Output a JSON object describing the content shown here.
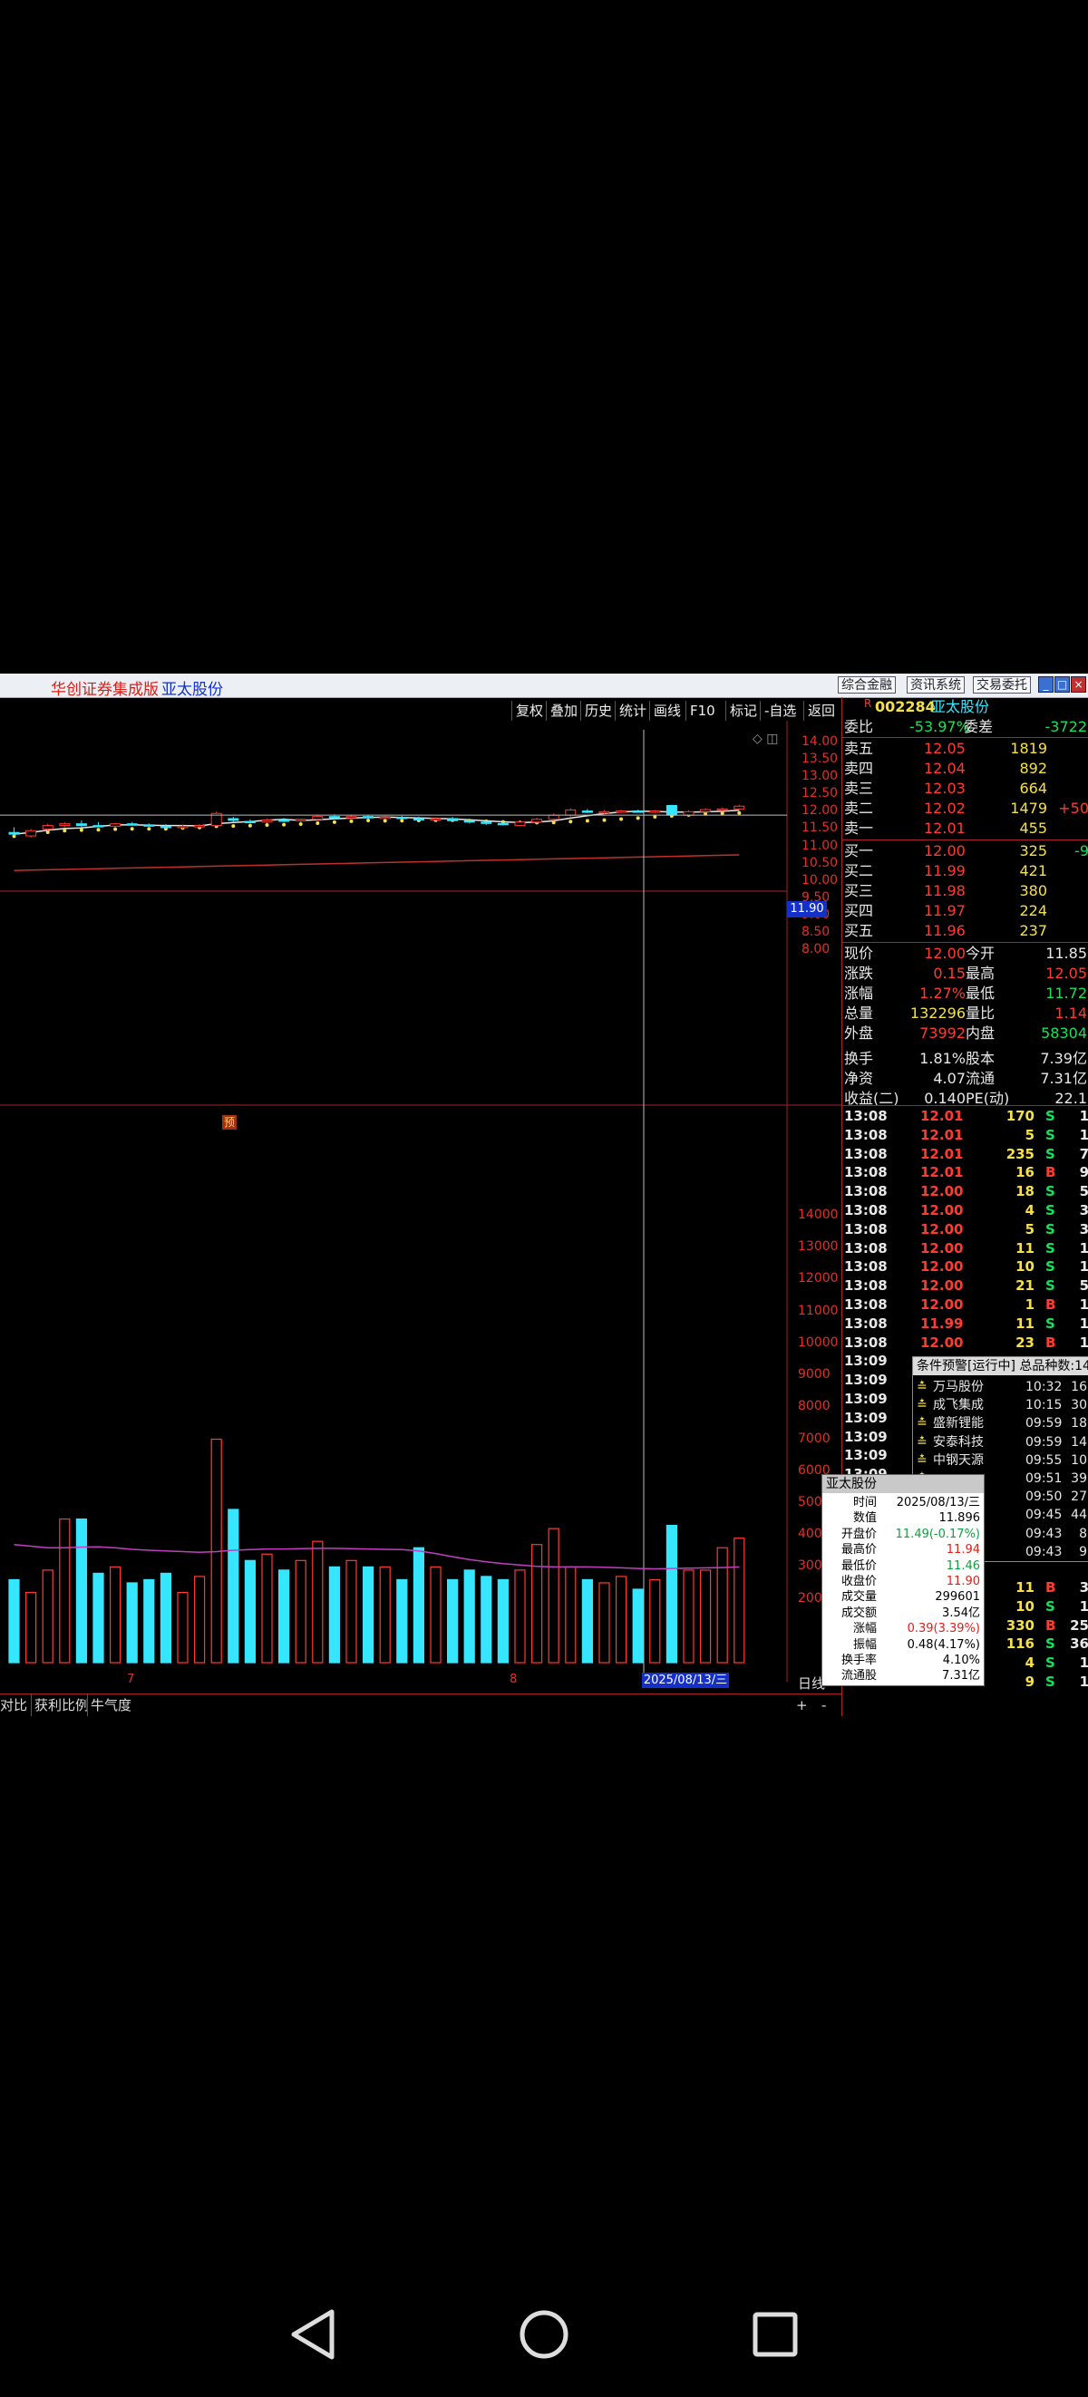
{
  "window": {
    "app_name": "华创证券集成版",
    "stock_name": "亚太股份",
    "top_buttons": [
      "综合金融",
      "资讯系统",
      "交易委托"
    ]
  },
  "toolbar": {
    "items": [
      "复权",
      "叠加",
      "历史",
      "统计",
      "画线",
      "F10",
      "标记",
      "-自选",
      "返回"
    ]
  },
  "price_axis": {
    "ticks": [
      "14.00",
      "13.50",
      "13.00",
      "12.50",
      "12.00",
      "11.50",
      "11.00",
      "10.50",
      "10.00",
      "9.50",
      "9.00",
      "8.50",
      "8.00"
    ],
    "crosshair_label": "11.90"
  },
  "volume_axis": {
    "ticks": [
      "14000",
      "13000",
      "12000",
      "11000",
      "10000",
      "9000",
      "8000",
      "7000",
      "6000",
      "5000",
      "4000",
      "3000",
      "2000"
    ]
  },
  "chart_data": {
    "type": "candlestick",
    "ohlc": [
      [
        11.4,
        11.55,
        11.3,
        11.35
      ],
      [
        11.3,
        11.5,
        11.25,
        11.45
      ],
      [
        11.5,
        11.65,
        11.45,
        11.6
      ],
      [
        11.6,
        11.7,
        11.55,
        11.65
      ],
      [
        11.65,
        11.75,
        11.55,
        11.6
      ],
      [
        11.6,
        11.7,
        11.55,
        11.58
      ],
      [
        11.58,
        11.68,
        11.55,
        11.65
      ],
      [
        11.65,
        11.7,
        11.6,
        11.62
      ],
      [
        11.62,
        11.66,
        11.58,
        11.6
      ],
      [
        11.58,
        11.64,
        11.52,
        11.55
      ],
      [
        11.55,
        11.62,
        11.5,
        11.58
      ],
      [
        11.58,
        11.64,
        11.54,
        11.6
      ],
      [
        11.6,
        12.0,
        11.58,
        11.95
      ],
      [
        11.8,
        11.85,
        11.7,
        11.75
      ],
      [
        11.72,
        11.78,
        11.66,
        11.7
      ],
      [
        11.7,
        11.8,
        11.66,
        11.76
      ],
      [
        11.76,
        11.82,
        11.7,
        11.74
      ],
      [
        11.74,
        11.8,
        11.7,
        11.78
      ],
      [
        11.78,
        11.9,
        11.74,
        11.86
      ],
      [
        11.86,
        11.92,
        11.8,
        11.84
      ],
      [
        11.84,
        11.9,
        11.8,
        11.86
      ],
      [
        11.86,
        11.9,
        11.8,
        11.82
      ],
      [
        11.82,
        11.88,
        11.78,
        11.84
      ],
      [
        11.84,
        11.88,
        11.78,
        11.8
      ],
      [
        11.8,
        11.86,
        11.76,
        11.78
      ],
      [
        11.78,
        11.84,
        11.74,
        11.8
      ],
      [
        11.8,
        11.85,
        11.72,
        11.74
      ],
      [
        11.74,
        11.78,
        11.66,
        11.7
      ],
      [
        11.7,
        11.74,
        11.62,
        11.66
      ],
      [
        11.66,
        11.7,
        11.6,
        11.64
      ],
      [
        11.6,
        11.72,
        11.58,
        11.7
      ],
      [
        11.7,
        11.82,
        11.66,
        11.78
      ],
      [
        11.78,
        11.95,
        11.74,
        11.9
      ],
      [
        11.9,
        12.1,
        11.86,
        12.05
      ],
      [
        12.02,
        12.08,
        11.96,
        12.0
      ],
      [
        11.98,
        12.04,
        11.92,
        12.0
      ],
      [
        12.0,
        12.06,
        11.96,
        12.02
      ],
      [
        12.02,
        12.06,
        11.98,
        12.0
      ],
      [
        12.0,
        12.05,
        11.96,
        12.02
      ],
      [
        12.18,
        12.2,
        11.9,
        11.9
      ],
      [
        11.9,
        12.04,
        11.88,
        12.0
      ],
      [
        12.0,
        12.1,
        11.96,
        12.06
      ],
      [
        12.06,
        12.12,
        12.0,
        12.08
      ],
      [
        12.08,
        12.2,
        12.04,
        12.16
      ]
    ],
    "volume": [
      2600,
      2200,
      2900,
      4500,
      4500,
      2800,
      3000,
      2500,
      2600,
      2800,
      2200,
      2700,
      7000,
      4800,
      3200,
      3400,
      2900,
      3200,
      3800,
      3000,
      3200,
      3000,
      3000,
      2600,
      3600,
      3000,
      2600,
      2900,
      2700,
      2600,
      2900,
      3700,
      4200,
      3000,
      2600,
      2500,
      2700,
      2300,
      2600,
      4300,
      2900,
      2900,
      3600,
      3900
    ],
    "volume_ma": [
      3700,
      3650,
      3600,
      3600,
      3620,
      3630,
      3600,
      3550,
      3520,
      3500,
      3480,
      3460,
      3480,
      3520,
      3540,
      3560,
      3560,
      3570,
      3580,
      3580,
      3570,
      3560,
      3550,
      3540,
      3500,
      3420,
      3320,
      3230,
      3160,
      3100,
      3060,
      3020,
      3000,
      3000,
      3000,
      2990,
      2970,
      2950,
      2940,
      2950,
      2960,
      2970,
      2980,
      3000
    ],
    "volume_colors": "cyan = down day, red hollow = up day",
    "xlabels": [
      "7",
      "8"
    ],
    "cursor_date": "2025/08/13/三",
    "flag_label": "预"
  },
  "quote": {
    "code": "002284",
    "name": "亚太股份",
    "weibi_label": "委比",
    "weibi": "-53.97%",
    "weicha_label": "委差",
    "weicha": "-3722",
    "sells": [
      {
        "label": "卖五",
        "price": "12.05",
        "vol": "1819",
        "chg": ""
      },
      {
        "label": "卖四",
        "price": "12.04",
        "vol": "892",
        "chg": ""
      },
      {
        "label": "卖三",
        "price": "12.03",
        "vol": "664",
        "chg": ""
      },
      {
        "label": "卖二",
        "price": "12.02",
        "vol": "1479",
        "chg": "+50"
      },
      {
        "label": "卖一",
        "price": "12.01",
        "vol": "455",
        "chg": ""
      }
    ],
    "buys": [
      {
        "label": "买一",
        "price": "12.00",
        "vol": "325",
        "chg": "-9"
      },
      {
        "label": "买二",
        "price": "11.99",
        "vol": "421",
        "chg": ""
      },
      {
        "label": "买三",
        "price": "11.98",
        "vol": "380",
        "chg": ""
      },
      {
        "label": "买四",
        "price": "11.97",
        "vol": "224",
        "chg": ""
      },
      {
        "label": "买五",
        "price": "11.96",
        "vol": "237",
        "chg": ""
      }
    ],
    "stats": [
      {
        "l1": "现价",
        "v1": "12.00",
        "l2": "今开",
        "v2": "11.85",
        "c1": "r",
        "c2": "w"
      },
      {
        "l1": "涨跌",
        "v1": "0.15",
        "l2": "最高",
        "v2": "12.05",
        "c1": "r",
        "c2": "r"
      },
      {
        "l1": "涨幅",
        "v1": "1.27%",
        "l2": "最低",
        "v2": "11.72",
        "c1": "r",
        "c2": "g"
      },
      {
        "l1": "总量",
        "v1": "132296",
        "l2": "量比",
        "v2": "1.14",
        "c1": "y",
        "c2": "r"
      },
      {
        "l1": "外盘",
        "v1": "73992",
        "l2": "内盘",
        "v2": "58304",
        "c1": "r",
        "c2": "g"
      },
      {
        "l1": "换手",
        "v1": "1.81%",
        "l2": "股本",
        "v2": "7.39亿",
        "c1": "w",
        "c2": "w"
      },
      {
        "l1": "净资",
        "v1": "4.07",
        "l2": "流通",
        "v2": "7.31亿",
        "c1": "w",
        "c2": "w"
      },
      {
        "l1": "收益(二)",
        "v1": "0.140",
        "l2": "PE(动)",
        "v2": "22.1",
        "c1": "w",
        "c2": "w"
      }
    ]
  },
  "ticks": [
    {
      "time": "13:08",
      "price": "12.01",
      "vol": "170",
      "bs": "S",
      "n": "1"
    },
    {
      "time": "13:08",
      "price": "12.01",
      "vol": "5",
      "bs": "S",
      "n": "1"
    },
    {
      "time": "13:08",
      "price": "12.01",
      "vol": "235",
      "bs": "S",
      "n": "7"
    },
    {
      "time": "13:08",
      "price": "12.01",
      "vol": "16",
      "bs": "B",
      "n": "9"
    },
    {
      "time": "13:08",
      "price": "12.00",
      "vol": "18",
      "bs": "S",
      "n": "5"
    },
    {
      "time": "13:08",
      "price": "12.00",
      "vol": "4",
      "bs": "S",
      "n": "3"
    },
    {
      "time": "13:08",
      "price": "12.00",
      "vol": "5",
      "bs": "S",
      "n": "3"
    },
    {
      "time": "13:08",
      "price": "12.00",
      "vol": "11",
      "bs": "S",
      "n": "1"
    },
    {
      "time": "13:08",
      "price": "12.00",
      "vol": "10",
      "bs": "S",
      "n": "1"
    },
    {
      "time": "13:08",
      "price": "12.00",
      "vol": "21",
      "bs": "S",
      "n": "5"
    },
    {
      "time": "13:08",
      "price": "12.00",
      "vol": "1",
      "bs": "B",
      "n": "1"
    },
    {
      "time": "13:08",
      "price": "11.99",
      "vol": "11",
      "bs": "S",
      "n": "1"
    },
    {
      "time": "13:08",
      "price": "12.00",
      "vol": "23",
      "bs": "B",
      "n": "1"
    },
    {
      "time": "13:09",
      "price": "",
      "vol": "",
      "bs": "",
      "n": ""
    },
    {
      "time": "13:09",
      "price": "",
      "vol": "",
      "bs": "",
      "n": ""
    },
    {
      "time": "13:09",
      "price": "",
      "vol": "",
      "bs": "",
      "n": ""
    },
    {
      "time": "13:09",
      "price": "",
      "vol": "",
      "bs": "",
      "n": ""
    },
    {
      "time": "13:09",
      "price": "",
      "vol": "",
      "bs": "",
      "n": ""
    },
    {
      "time": "13:09",
      "price": "",
      "vol": "",
      "bs": "",
      "n": ""
    },
    {
      "time": "13:09",
      "price": "",
      "vol": "",
      "bs": "",
      "n": ""
    },
    {
      "time": "13:09",
      "price": "",
      "vol": "",
      "bs": "",
      "n": ""
    },
    {
      "time": "13:09",
      "price": "",
      "vol": "",
      "bs": "",
      "n": ""
    },
    {
      "time": "13:09",
      "price": "",
      "vol": "",
      "bs": "",
      "n": ""
    },
    {
      "time": "13:09",
      "price": "",
      "vol": "",
      "bs": "",
      "n": ""
    },
    {
      "time": "13:09",
      "price": "",
      "vol": "",
      "bs": "",
      "n": ""
    },
    {
      "time": "13:09",
      "price": "",
      "vol": "11",
      "bs": "B",
      "n": "3"
    },
    {
      "time": "13:09",
      "price": "",
      "vol": "10",
      "bs": "S",
      "n": "1"
    },
    {
      "time": "13:09",
      "price": "",
      "vol": "330",
      "bs": "B",
      "n": "25"
    },
    {
      "time": "13:09",
      "price": "",
      "vol": "116",
      "bs": "S",
      "n": "36"
    },
    {
      "time": "13:09",
      "price": "",
      "vol": "4",
      "bs": "S",
      "n": "1"
    },
    {
      "time": "13:09",
      "price": "",
      "vol": "9",
      "bs": "S",
      "n": "1"
    }
  ],
  "alert_panel": {
    "title": "条件预警[运行中] 总品种数:14",
    "items": [
      {
        "name": "万马股份",
        "time": "10:32",
        "n": "16"
      },
      {
        "name": "成飞集成",
        "time": "10:15",
        "n": "30"
      },
      {
        "name": "盛新锂能",
        "time": "09:59",
        "n": "18"
      },
      {
        "name": "安泰科技",
        "time": "09:59",
        "n": "14"
      },
      {
        "name": "中钢天源",
        "time": "09:55",
        "n": "10"
      },
      {
        "name": "",
        "time": "09:51",
        "n": "39"
      },
      {
        "name": "",
        "time": "09:50",
        "n": "27"
      },
      {
        "name": "",
        "time": "09:45",
        "n": "44"
      },
      {
        "name": "",
        "time": "09:43",
        "n": "8"
      },
      {
        "name": "",
        "time": "09:43",
        "n": "9"
      }
    ]
  },
  "tooltip": {
    "title": "亚太股份",
    "rows": [
      {
        "label": "时间",
        "value": "2025/08/13/三",
        "c": "k"
      },
      {
        "label": "数值",
        "value": "11.896",
        "c": "k"
      },
      {
        "label": "开盘价",
        "value": "11.49(-0.17%)",
        "c": "g"
      },
      {
        "label": "最高价",
        "value": "11.94",
        "c": "r"
      },
      {
        "label": "最低价",
        "value": "11.46",
        "c": "g"
      },
      {
        "label": "收盘价",
        "value": "11.90",
        "c": "r"
      },
      {
        "label": "成交量",
        "value": "299601",
        "c": "k"
      },
      {
        "label": "成交额",
        "value": "3.54亿",
        "c": "k"
      },
      {
        "label": "涨幅",
        "value": "0.39(3.39%)",
        "c": "r"
      },
      {
        "label": "振幅",
        "value": "0.48(4.17%)",
        "c": "k"
      },
      {
        "label": "换手率",
        "value": "4.10%",
        "c": "k"
      },
      {
        "label": "流通股",
        "value": "7.31亿",
        "c": "k"
      }
    ]
  },
  "bottom_tabs": [
    "对比",
    "获利比例",
    "牛气度"
  ],
  "bottom_right": {
    "day_label": "日线",
    "plus": "+",
    "minus": "-"
  },
  "colors": {
    "up": "#ff3b30",
    "down": "#36e6ff",
    "ma_white": "#e8e8e8",
    "ma_yellow": "#f5e04a",
    "ma_long": "#c0302a",
    "vol_ma": "#c040c0"
  }
}
